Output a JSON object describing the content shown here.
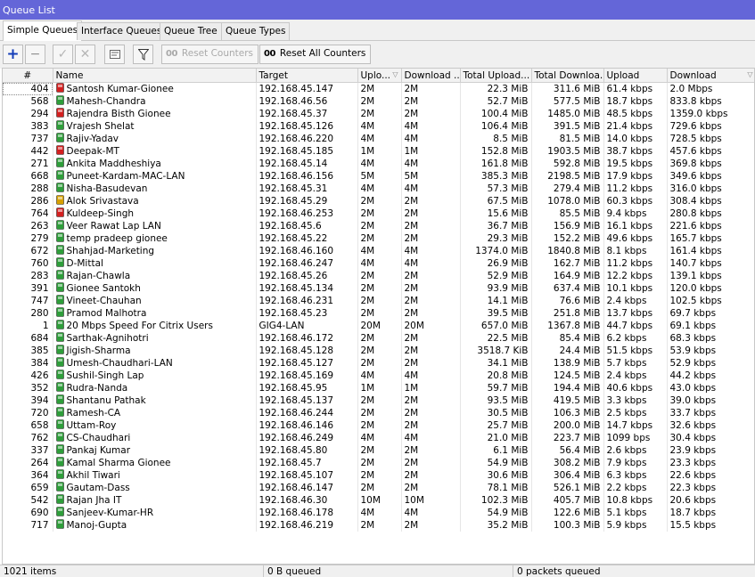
{
  "window": {
    "title": "Queue List"
  },
  "tabs": [
    "Simple Queues",
    "Interface Queues",
    "Queue Tree",
    "Queue Types"
  ],
  "toolbar": {
    "add_icon": "plus-icon",
    "remove_icon": "minus-icon",
    "enable_icon": "check-icon",
    "disable_icon": "x-icon",
    "comment_icon": "comment-icon",
    "filter_icon": "filter-icon",
    "oo_glyph": "00",
    "reset_counters_label": "Reset Counters",
    "reset_all_counters_label": "Reset All Counters"
  },
  "columns": {
    "num": "#",
    "name": "Name",
    "target": "Target",
    "upload_max": "Uplo...",
    "download_max": "Download ...",
    "total_upload": "Total Upload...",
    "total_download": "Total Downloa...",
    "upload": "Upload",
    "download": "Download"
  },
  "colors": {
    "titlebar": "#6466d8",
    "queue_green": "#2e9e3a",
    "queue_red": "#d42020"
  },
  "rows": [
    {
      "num": "404",
      "name": "Santosh Kumar-Gionee",
      "icon": "red",
      "target": "192.168.45.147",
      "umax": "2M",
      "dmax": "2M",
      "tu": "22.3 MiB",
      "td": "311.6 MiB",
      "up": "61.4 kbps",
      "down": "2.0 Mbps"
    },
    {
      "num": "568",
      "name": "Mahesh-Chandra",
      "icon": "green",
      "target": "192.168.46.56",
      "umax": "2M",
      "dmax": "2M",
      "tu": "52.7 MiB",
      "td": "577.5 MiB",
      "up": "18.7 kbps",
      "down": "833.8 kbps"
    },
    {
      "num": "294",
      "name": "Rajendra Bisth Gionee",
      "icon": "red",
      "target": "192.168.45.37",
      "umax": "2M",
      "dmax": "2M",
      "tu": "100.4 MiB",
      "td": "1485.0 MiB",
      "up": "48.5 kbps",
      "down": "1359.0 kbps"
    },
    {
      "num": "383",
      "name": "Vrajesh Shelat",
      "icon": "green",
      "target": "192.168.45.126",
      "umax": "4M",
      "dmax": "4M",
      "tu": "106.4 MiB",
      "td": "391.5 MiB",
      "up": "21.4 kbps",
      "down": "729.6 kbps"
    },
    {
      "num": "737",
      "name": "Rajiv-Yadav",
      "icon": "green",
      "target": "192.168.46.220",
      "umax": "4M",
      "dmax": "4M",
      "tu": "8.5 MiB",
      "td": "81.5 MiB",
      "up": "14.0 kbps",
      "down": "728.5 kbps"
    },
    {
      "num": "442",
      "name": "Deepak-MT",
      "icon": "red",
      "target": "192.168.45.185",
      "umax": "1M",
      "dmax": "1M",
      "tu": "152.8 MiB",
      "td": "1903.5 MiB",
      "up": "38.7 kbps",
      "down": "457.6 kbps"
    },
    {
      "num": "271",
      "name": "Ankita Maddheshiya",
      "icon": "green",
      "target": "192.168.45.14",
      "umax": "4M",
      "dmax": "4M",
      "tu": "161.8 MiB",
      "td": "592.8 MiB",
      "up": "19.5 kbps",
      "down": "369.8 kbps"
    },
    {
      "num": "668",
      "name": "Puneet-Kardam-MAC-LAN",
      "icon": "green",
      "target": "192.168.46.156",
      "umax": "5M",
      "dmax": "5M",
      "tu": "385.3 MiB",
      "td": "2198.5 MiB",
      "up": "17.9 kbps",
      "down": "349.6 kbps"
    },
    {
      "num": "288",
      "name": "Nisha-Basudevan",
      "icon": "green",
      "target": "192.168.45.31",
      "umax": "4M",
      "dmax": "4M",
      "tu": "57.3 MiB",
      "td": "279.4 MiB",
      "up": "11.2 kbps",
      "down": "316.0 kbps"
    },
    {
      "num": "286",
      "name": "Alok Srivastava",
      "icon": "yellow",
      "target": "192.168.45.29",
      "umax": "2M",
      "dmax": "2M",
      "tu": "67.5 MiB",
      "td": "1078.0 MiB",
      "up": "60.3 kbps",
      "down": "308.4 kbps"
    },
    {
      "num": "764",
      "name": "Kuldeep-Singh",
      "icon": "red",
      "target": "192.168.46.253",
      "umax": "2M",
      "dmax": "2M",
      "tu": "15.6 MiB",
      "td": "85.5 MiB",
      "up": "9.4 kbps",
      "down": "280.8 kbps"
    },
    {
      "num": "263",
      "name": "Veer Rawat Lap LAN",
      "icon": "green",
      "target": "192.168.45.6",
      "umax": "2M",
      "dmax": "2M",
      "tu": "36.7 MiB",
      "td": "156.9 MiB",
      "up": "16.1 kbps",
      "down": "221.6 kbps"
    },
    {
      "num": "279",
      "name": "temp pradeep gionee",
      "icon": "green",
      "target": "192.168.45.22",
      "umax": "2M",
      "dmax": "2M",
      "tu": "29.3 MiB",
      "td": "152.2 MiB",
      "up": "49.6 kbps",
      "down": "165.7 kbps"
    },
    {
      "num": "672",
      "name": "Shahjad-Marketing",
      "icon": "green",
      "target": "192.168.46.160",
      "umax": "4M",
      "dmax": "4M",
      "tu": "1374.0 MiB",
      "td": "1840.8 MiB",
      "up": "8.1 kbps",
      "down": "161.4 kbps"
    },
    {
      "num": "760",
      "name": "D-Mittal",
      "icon": "green",
      "target": "192.168.46.247",
      "umax": "4M",
      "dmax": "4M",
      "tu": "26.9 MiB",
      "td": "162.7 MiB",
      "up": "11.2 kbps",
      "down": "140.7 kbps"
    },
    {
      "num": "283",
      "name": "Rajan-Chawla",
      "icon": "green",
      "target": "192.168.45.26",
      "umax": "2M",
      "dmax": "2M",
      "tu": "52.9 MiB",
      "td": "164.9 MiB",
      "up": "12.2 kbps",
      "down": "139.1 kbps"
    },
    {
      "num": "391",
      "name": "Gionee Santokh",
      "icon": "green",
      "target": "192.168.45.134",
      "umax": "2M",
      "dmax": "2M",
      "tu": "93.9 MiB",
      "td": "637.4 MiB",
      "up": "10.1 kbps",
      "down": "120.0 kbps"
    },
    {
      "num": "747",
      "name": "Vineet-Chauhan",
      "icon": "green",
      "target": "192.168.46.231",
      "umax": "2M",
      "dmax": "2M",
      "tu": "14.1 MiB",
      "td": "76.6 MiB",
      "up": "2.4 kbps",
      "down": "102.5 kbps"
    },
    {
      "num": "280",
      "name": "Pramod Malhotra",
      "icon": "green",
      "target": "192.168.45.23",
      "umax": "2M",
      "dmax": "2M",
      "tu": "39.5 MiB",
      "td": "251.8 MiB",
      "up": "13.7 kbps",
      "down": "69.7 kbps"
    },
    {
      "num": "1",
      "name": "20 Mbps Speed For Citrix Users",
      "icon": "green",
      "target": "GIG4-LAN",
      "umax": "20M",
      "dmax": "20M",
      "tu": "657.0 MiB",
      "td": "1367.8 MiB",
      "up": "44.7 kbps",
      "down": "69.1 kbps"
    },
    {
      "num": "684",
      "name": "Sarthak-Agnihotri",
      "icon": "green",
      "target": "192.168.46.172",
      "umax": "2M",
      "dmax": "2M",
      "tu": "22.5 MiB",
      "td": "85.4 MiB",
      "up": "6.2 kbps",
      "down": "68.3 kbps"
    },
    {
      "num": "385",
      "name": "Jigish-Sharma",
      "icon": "green",
      "target": "192.168.45.128",
      "umax": "2M",
      "dmax": "2M",
      "tu": "3518.7 KiB",
      "td": "24.4 MiB",
      "up": "51.5 kbps",
      "down": "53.9 kbps"
    },
    {
      "num": "384",
      "name": "Umesh-Chaudhari-LAN",
      "icon": "green",
      "target": "192.168.45.127",
      "umax": "2M",
      "dmax": "2M",
      "tu": "34.1 MiB",
      "td": "138.9 MiB",
      "up": "5.7 kbps",
      "down": "52.9 kbps"
    },
    {
      "num": "426",
      "name": "Sushil-Singh Lap",
      "icon": "green",
      "target": "192.168.45.169",
      "umax": "4M",
      "dmax": "4M",
      "tu": "20.8 MiB",
      "td": "124.5 MiB",
      "up": "2.4 kbps",
      "down": "44.2 kbps"
    },
    {
      "num": "352",
      "name": "Rudra-Nanda",
      "icon": "green",
      "target": "192.168.45.95",
      "umax": "1M",
      "dmax": "1M",
      "tu": "59.7 MiB",
      "td": "194.4 MiB",
      "up": "40.6 kbps",
      "down": "43.0 kbps"
    },
    {
      "num": "394",
      "name": "Shantanu Pathak",
      "icon": "green",
      "target": "192.168.45.137",
      "umax": "2M",
      "dmax": "2M",
      "tu": "93.5 MiB",
      "td": "419.5 MiB",
      "up": "3.3 kbps",
      "down": "39.0 kbps"
    },
    {
      "num": "720",
      "name": "Ramesh-CA",
      "icon": "green",
      "target": "192.168.46.244",
      "umax": "2M",
      "dmax": "2M",
      "tu": "30.5 MiB",
      "td": "106.3 MiB",
      "up": "2.5 kbps",
      "down": "33.7 kbps"
    },
    {
      "num": "658",
      "name": "Uttam-Roy",
      "icon": "green",
      "target": "192.168.46.146",
      "umax": "2M",
      "dmax": "2M",
      "tu": "25.7 MiB",
      "td": "200.0 MiB",
      "up": "14.7 kbps",
      "down": "32.6 kbps"
    },
    {
      "num": "762",
      "name": "CS-Chaudhari",
      "icon": "green",
      "target": "192.168.46.249",
      "umax": "4M",
      "dmax": "4M",
      "tu": "21.0 MiB",
      "td": "223.7 MiB",
      "up": "1099 bps",
      "down": "30.4 kbps"
    },
    {
      "num": "337",
      "name": "Pankaj Kumar",
      "icon": "green",
      "target": "192.168.45.80",
      "umax": "2M",
      "dmax": "2M",
      "tu": "6.1 MiB",
      "td": "56.4 MiB",
      "up": "2.6 kbps",
      "down": "23.9 kbps"
    },
    {
      "num": "264",
      "name": "Kamal Sharma Gionee",
      "icon": "green",
      "target": "192.168.45.7",
      "umax": "2M",
      "dmax": "2M",
      "tu": "54.9 MiB",
      "td": "308.2 MiB",
      "up": "7.9 kbps",
      "down": "23.3 kbps"
    },
    {
      "num": "364",
      "name": "Akhil Tiwari",
      "icon": "green",
      "target": "192.168.45.107",
      "umax": "2M",
      "dmax": "2M",
      "tu": "30.6 MiB",
      "td": "306.4 MiB",
      "up": "6.3 kbps",
      "down": "22.6 kbps"
    },
    {
      "num": "659",
      "name": "Gautam-Dass",
      "icon": "green",
      "target": "192.168.46.147",
      "umax": "2M",
      "dmax": "2M",
      "tu": "78.1 MiB",
      "td": "526.1 MiB",
      "up": "2.2 kbps",
      "down": "22.3 kbps"
    },
    {
      "num": "542",
      "name": "Rajan Jha IT",
      "icon": "green",
      "target": "192.168.46.30",
      "umax": "10M",
      "dmax": "10M",
      "tu": "102.3 MiB",
      "td": "405.7 MiB",
      "up": "10.8 kbps",
      "down": "20.6 kbps"
    },
    {
      "num": "690",
      "name": "Sanjeev-Kumar-HR",
      "icon": "green",
      "target": "192.168.46.178",
      "umax": "4M",
      "dmax": "4M",
      "tu": "54.9 MiB",
      "td": "122.6 MiB",
      "up": "5.1 kbps",
      "down": "18.7 kbps"
    },
    {
      "num": "717",
      "name": "Manoj-Gupta",
      "icon": "green",
      "target": "192.168.46.219",
      "umax": "2M",
      "dmax": "2M",
      "tu": "35.2 MiB",
      "td": "100.3 MiB",
      "up": "5.9 kbps",
      "down": "15.5 kbps"
    }
  ],
  "status": {
    "items": "1021 items",
    "queued_bytes": "0 B queued",
    "queued_packets": "0 packets queued"
  }
}
